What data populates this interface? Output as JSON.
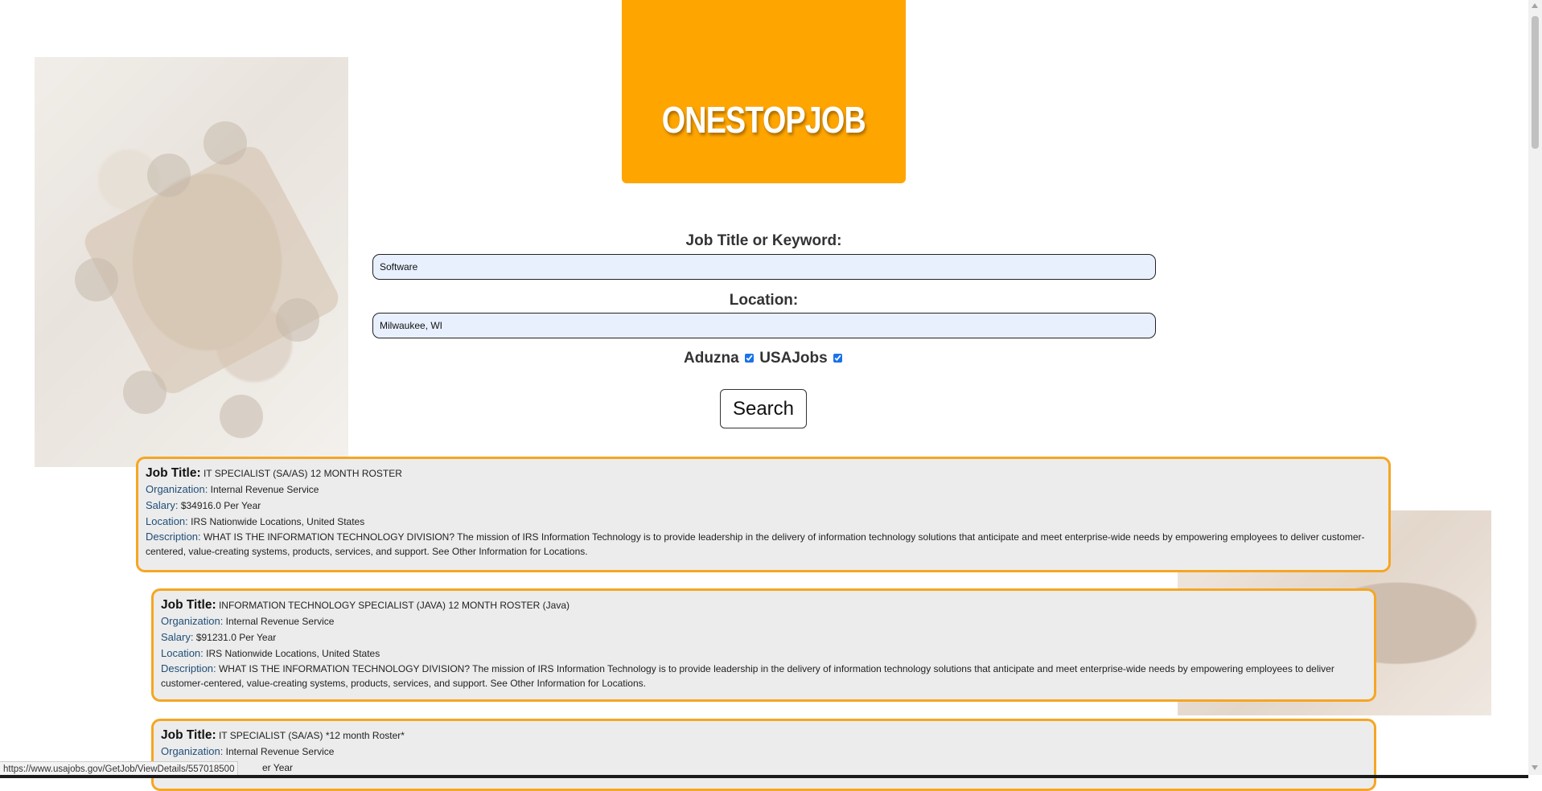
{
  "brand": {
    "logo_text": "ONESTOPJOB",
    "color": "#ffa500"
  },
  "search_form": {
    "keyword_label": "Job Title or Keyword:",
    "keyword_value": "Software",
    "location_label": "Location:",
    "location_value": "Milwaukee, WI",
    "source_aduzna_label": "Aduzna",
    "source_aduzna_checked": true,
    "source_usajobs_label": "USAJobs",
    "source_usajobs_checked": true,
    "search_button": "Search"
  },
  "labels": {
    "job_title": "Job Title:",
    "organization": "Organization:",
    "salary": "Salary:",
    "location": "Location:",
    "description": "Description:"
  },
  "results": [
    {
      "title": "IT SPECIALIST (SA/AS) 12 MONTH ROSTER",
      "organization": "Internal Revenue Service",
      "salary": "$34916.0 Per Year",
      "location": "IRS Nationwide Locations, United States",
      "description": "WHAT IS THE INFORMATION TECHNOLOGY DIVISION? The mission of IRS Information Technology is to provide leadership in the delivery of information technology solutions that anticipate and meet enterprise-wide needs by empowering employees to deliver customer-centered, value-creating systems, products, services, and support. See Other Information for Locations."
    },
    {
      "title": "INFORMATION TECHNOLOGY SPECIALIST (JAVA) 12 MONTH ROSTER (Java)",
      "organization": "Internal Revenue Service",
      "salary": "$91231.0 Per Year",
      "location": "IRS Nationwide Locations, United States",
      "description": "WHAT IS THE INFORMATION TECHNOLOGY DIVISION? The mission of IRS Information Technology is to provide leadership in the delivery of information technology solutions that anticipate and meet enterprise-wide needs by empowering employees to deliver customer-centered, value-creating systems, products, services, and support. See Other Information for Locations."
    },
    {
      "title": "IT SPECIALIST (SA/AS) *12 month Roster*",
      "organization": "Internal Revenue Service",
      "salary_visible_fragment": "er Year"
    }
  ],
  "status_bar": {
    "url": "https://www.usajobs.gov/GetJob/ViewDetails/557018500"
  }
}
